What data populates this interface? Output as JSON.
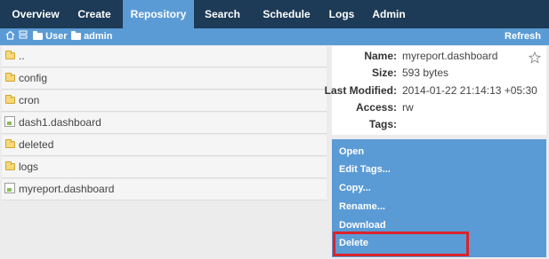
{
  "nav": {
    "items": [
      {
        "label": "Overview"
      },
      {
        "label": "Create"
      },
      {
        "label": "Repository",
        "active": true
      },
      {
        "label": "Search"
      },
      {
        "label": "Schedule"
      },
      {
        "label": "Logs"
      },
      {
        "label": "Admin"
      }
    ]
  },
  "breadcrumb": {
    "items": [
      {
        "label": "User"
      },
      {
        "label": "admin"
      }
    ],
    "refresh_label": "Refresh"
  },
  "files": [
    {
      "name": "..",
      "type": "folder"
    },
    {
      "name": "config",
      "type": "folder"
    },
    {
      "name": "cron",
      "type": "folder"
    },
    {
      "name": "dash1.dashboard",
      "type": "dashboard"
    },
    {
      "name": "deleted",
      "type": "folder"
    },
    {
      "name": "logs",
      "type": "folder"
    },
    {
      "name": "myreport.dashboard",
      "type": "dashboard"
    }
  ],
  "details": {
    "name_label": "Name:",
    "name_value": "myreport.dashboard",
    "size_label": "Size:",
    "size_value": "593 bytes",
    "modified_label": "Last Modified:",
    "modified_value": "2014-01-22 21:14:13 +05:30",
    "access_label": "Access:",
    "access_value": "rw",
    "tags_label": "Tags:",
    "tags_value": ""
  },
  "actions": {
    "items": [
      {
        "label": "Open"
      },
      {
        "label": "Edit Tags..."
      },
      {
        "label": "Copy..."
      },
      {
        "label": "Rename..."
      },
      {
        "label": "Download"
      },
      {
        "label": "Delete",
        "highlighted": true
      }
    ]
  },
  "colors": {
    "nav_bg": "#1d3a56",
    "accent": "#5b9bd5",
    "highlight": "#d8242c",
    "folder": "#f6d97a"
  }
}
